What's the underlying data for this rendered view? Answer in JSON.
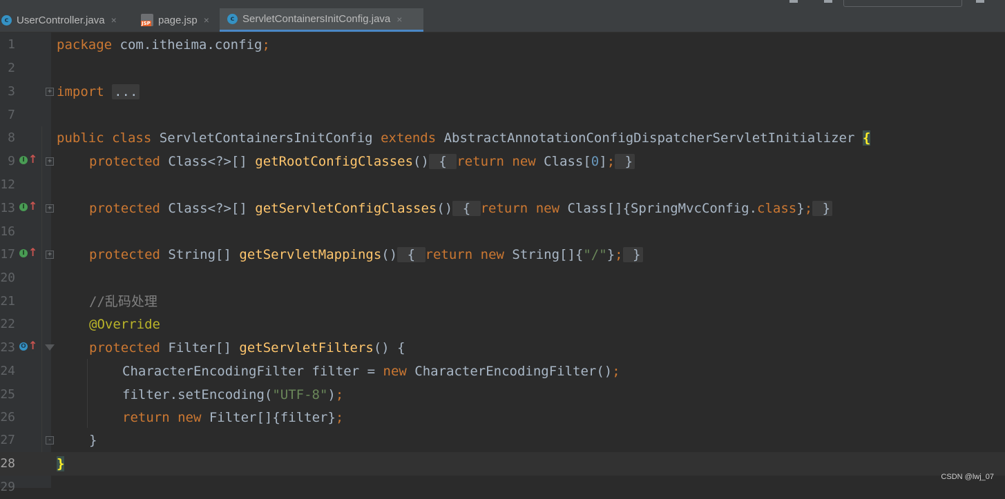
{
  "tabs": [
    {
      "label": "UserController.java",
      "icon": "java-class-icon",
      "active": false
    },
    {
      "label": "page.jsp",
      "icon": "jsp-file-icon",
      "active": false
    },
    {
      "label": "ServletContainersInitConfig.java",
      "icon": "java-class-icon",
      "active": true
    }
  ],
  "tab_icon_glyph": "c",
  "jsp_badge": "JSP",
  "close_glyph": "×",
  "lines": [
    {
      "num": "1"
    },
    {
      "num": "2"
    },
    {
      "num": "3"
    },
    {
      "num": "7"
    },
    {
      "num": "8"
    },
    {
      "num": "9"
    },
    {
      "num": "12"
    },
    {
      "num": "13"
    },
    {
      "num": "16"
    },
    {
      "num": "17"
    },
    {
      "num": "20"
    },
    {
      "num": "21"
    },
    {
      "num": "22"
    },
    {
      "num": "23"
    },
    {
      "num": "24"
    },
    {
      "num": "25"
    },
    {
      "num": "26"
    },
    {
      "num": "27"
    },
    {
      "num": "28"
    },
    {
      "num": "29"
    }
  ],
  "code": {
    "package_kw": "package",
    "package_name": "com.itheima.config",
    "semicolon": ";",
    "import_kw": "import",
    "import_fold": "...",
    "public_kw": "public",
    "class_kw": "class",
    "class_name": "ServletContainersInitConfig",
    "extends_kw": "extends",
    "super_name": "AbstractAnnotationConfigDispatcherServletInitializer",
    "open_brace": "{",
    "close_brace": "}",
    "protected_kw": "protected",
    "return_kw": "return",
    "new_kw": "new",
    "root_type": "Class<?>[]",
    "root_fn": "getRootConfigClasses",
    "root_body_a": "Class[",
    "root_body_num": "0",
    "root_body_b": "]",
    "servlet_type": "Class<?>[]",
    "servlet_fn": "getServletConfigClasses",
    "servlet_body_a": "Class[]{SpringMvcConfig.",
    "servlet_body_class": "class",
    "servlet_body_b": "}",
    "mapping_type": "String[]",
    "mapping_fn": "getServletMappings",
    "mapping_body_a": "String[]{",
    "mapping_body_str": "\"/\"",
    "mapping_body_b": "}",
    "parens": "()",
    "comment": "//乱码处理",
    "annotation": "@Override",
    "filters_type": "Filter[]",
    "filters_fn": "getServletFilters",
    "filters_sig_rest": "() {",
    "l24_a": "CharacterEncodingFilter filter = ",
    "l24_b": " CharacterEncodingFilter()",
    "l25_a": "filter.setEncoding(",
    "l25_str": "\"UTF-8\"",
    "l25_b": ")",
    "l26_b": " Filter[]{filter}",
    "gutter_impl_glyph": "I",
    "gutter_ovr_glyph": "O",
    "gutter_arrow": "↑"
  },
  "watermark": "CSDN @lwj_07"
}
